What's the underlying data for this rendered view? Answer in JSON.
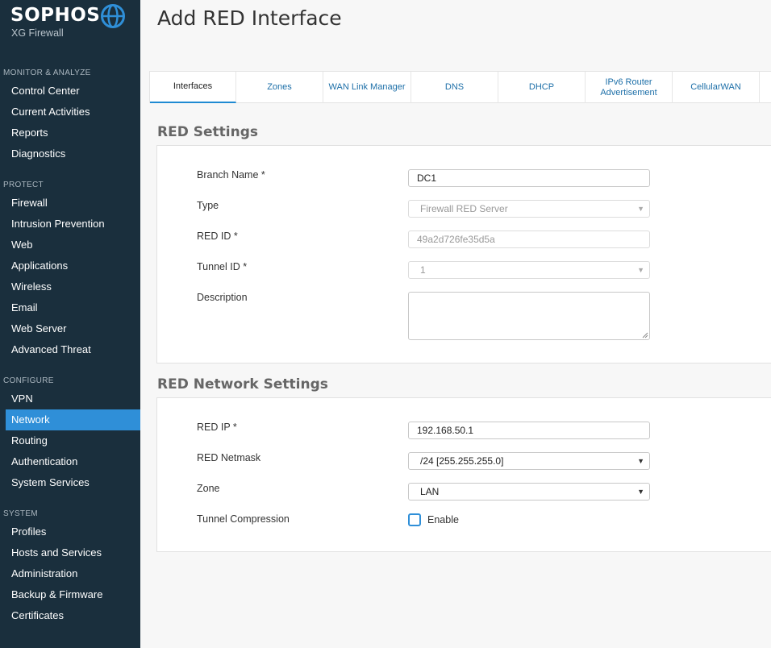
{
  "brand": {
    "name": "SOPHOS",
    "product": "XG Firewall",
    "globe_icon": "globe-icon"
  },
  "sidebar": {
    "sections": [
      {
        "title": "MONITOR & ANALYZE",
        "items": [
          "Control Center",
          "Current Activities",
          "Reports",
          "Diagnostics"
        ]
      },
      {
        "title": "PROTECT",
        "items": [
          "Firewall",
          "Intrusion Prevention",
          "Web",
          "Applications",
          "Wireless",
          "Email",
          "Web Server",
          "Advanced Threat"
        ]
      },
      {
        "title": "CONFIGURE",
        "items": [
          "VPN",
          "Network",
          "Routing",
          "Authentication",
          "System Services"
        ]
      },
      {
        "title": "SYSTEM",
        "items": [
          "Profiles",
          "Hosts and Services",
          "Administration",
          "Backup & Firmware",
          "Certificates"
        ]
      }
    ],
    "active_item": "Network"
  },
  "page": {
    "title": "Add RED Interface"
  },
  "tabs": [
    {
      "label": "Interfaces",
      "active": true
    },
    {
      "label": "Zones"
    },
    {
      "label": "WAN Link Manager"
    },
    {
      "label": "DNS"
    },
    {
      "label": "DHCP"
    },
    {
      "label": "IPv6 Router Advertisement"
    },
    {
      "label": "CellularWAN"
    }
  ],
  "red_settings": {
    "title": "RED Settings",
    "branch_name": {
      "label": "Branch Name *",
      "value": "DC1"
    },
    "type": {
      "label": "Type",
      "value": "Firewall RED Server"
    },
    "red_id": {
      "label": "RED ID *",
      "value": "49a2d726fe35d5a"
    },
    "tunnel_id": {
      "label": "Tunnel ID *",
      "value": "1"
    },
    "description": {
      "label": "Description",
      "value": ""
    }
  },
  "red_network_settings": {
    "title": "RED Network Settings",
    "red_ip": {
      "label": "RED IP *",
      "value": "192.168.50.1"
    },
    "red_netmask": {
      "label": "RED Netmask",
      "value": "/24 [255.255.255.0]"
    },
    "zone": {
      "label": "Zone",
      "value": "LAN"
    },
    "tunnel_compression": {
      "label": "Tunnel Compression",
      "option_label": "Enable",
      "checked": false
    }
  },
  "colors": {
    "sidebar_bg": "#1a2f3d",
    "accent": "#2f8fd8",
    "tab_text": "#1d6fa8"
  }
}
